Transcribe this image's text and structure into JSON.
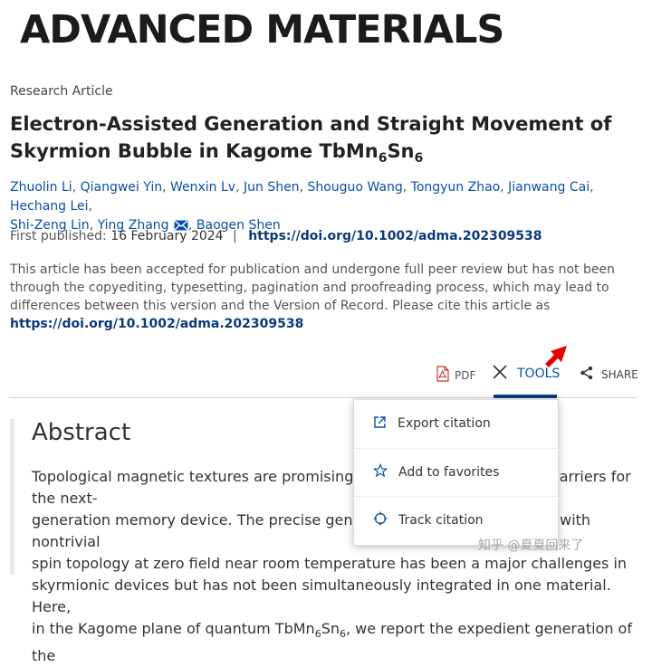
{
  "journal": {
    "name": "ADVANCED MATERIALS"
  },
  "article": {
    "type": "Research Article",
    "title_line1": "Electron-Assisted Generation and Straight Movement of",
    "title_line2_prefix": "Skyrmion Bubble in Kagome TbMn",
    "title_sub1": "6",
    "title_mid": "Sn",
    "title_sub2": "6",
    "authors": [
      "Zhuolin Li",
      "Qiangwei Yin",
      "Wenxin Lv",
      "Jun Shen",
      "Shouguo Wang",
      "Tongyun Zhao",
      "Jianwang Cai",
      "Hechang Lei",
      "Shi-Zeng Lin",
      "Ying Zhang",
      "Baogen Shen"
    ],
    "first_published_label": "First published:",
    "first_published_date": "16 February 2024",
    "separator": "|",
    "doi": "https://doi.org/10.1002/adma.202309538",
    "notice": "This article has been accepted for publication and undergone full peer review but has not been through the copyediting, typesetting, pagination and proofreading process, which may lead to differences between this version and the Version of Record. Please cite this article as",
    "notice_doi": "https://doi.org/10.1002/adma.202309538"
  },
  "toolbar": {
    "pdf_label": "PDF",
    "tools_label": "TOOLS",
    "share_label": "SHARE"
  },
  "tools_menu": {
    "items": [
      {
        "label": "Export citation",
        "icon": "export-icon"
      },
      {
        "label": "Add to favorites",
        "icon": "star-icon"
      },
      {
        "label": "Track citation",
        "icon": "target-icon"
      }
    ]
  },
  "abstract": {
    "heading": "Abstract",
    "line1": "Topological magnetic textures are promising candidates as information carriers for the next-",
    "line2": "generation memory device. The precise generation of skyrmion bubbles with nontrivial",
    "line3": "spin topology at zero field near room temperature has been a major challenges in",
    "line4": "skyrmionic devices but has not been simultaneously integrated in one material. Here,",
    "line5_prefix": "in the Kagome plane of quantum TbMn",
    "line5_sub1": "6",
    "line5_mid": "Sn",
    "line5_sub2": "6",
    "line5_suffix": ", we report the expedient generation of the"
  },
  "watermark": "知乎 @夏夏回来了",
  "colors": {
    "link": "#0b4fa8",
    "doi": "#0b3a7a",
    "arrow": "#e60000"
  }
}
